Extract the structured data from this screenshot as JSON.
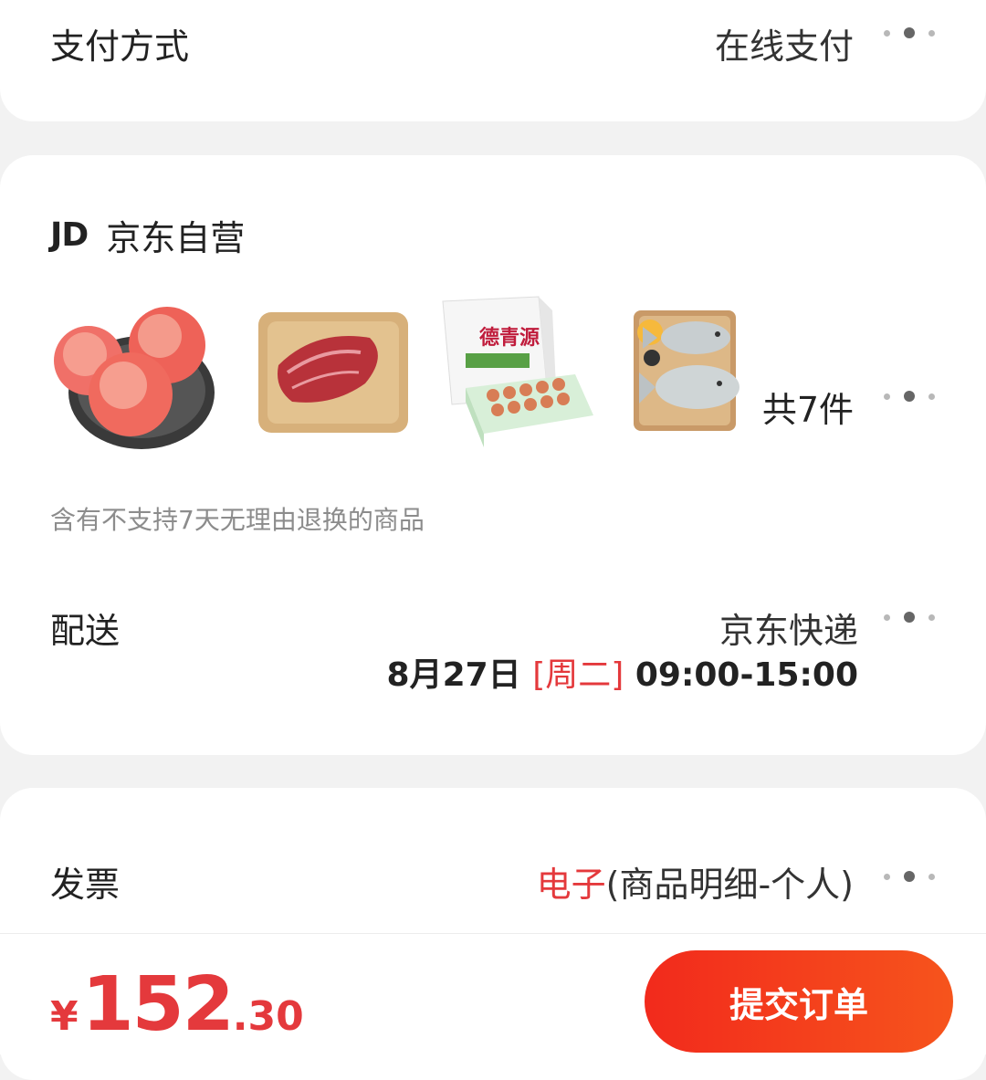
{
  "payment": {
    "label": "支付方式",
    "value": "在线支付"
  },
  "shop": {
    "logo": "JD",
    "name": "京东自营",
    "items": [
      {
        "name": "peach",
        "icon": "peach-image"
      },
      {
        "name": "steak",
        "icon": "steak-image"
      },
      {
        "name": "eggs",
        "icon": "egg-box-image"
      },
      {
        "name": "fish",
        "icon": "fish-image"
      }
    ],
    "count": "共7件",
    "notice": "含有不支持7天无理由退换的商品"
  },
  "delivery": {
    "label": "配送",
    "method": "京东快递",
    "date": "8月27日",
    "weekday": "[周二]",
    "time": "09:00-15:00"
  },
  "invoice": {
    "label": "发票",
    "type": "电子",
    "detail": "(商品明细-个人)"
  },
  "footer": {
    "currency": "¥",
    "price_int": "152",
    "price_dec": ".30",
    "submit_label": "提交订单"
  },
  "colors": {
    "accent": "#e4393c",
    "button_start": "#f22a1c",
    "button_end": "#f6541c"
  }
}
